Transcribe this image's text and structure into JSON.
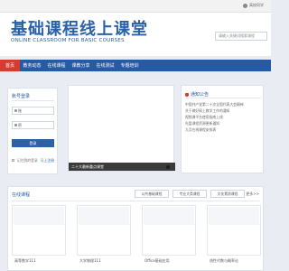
{
  "topbar": {
    "login_label": "高校同学"
  },
  "header": {
    "title": "基础课程线上课堂",
    "subtitle": "ONLINE CLASSROOM FOR BASIC COURSES",
    "search_placeholder": "请输入关键词搜索课程"
  },
  "nav": {
    "items": [
      {
        "label": "首页"
      },
      {
        "label": "教务动态"
      },
      {
        "label": "在线课程"
      },
      {
        "label": "课教分享"
      },
      {
        "label": "在线测试"
      },
      {
        "label": "专题培训"
      }
    ]
  },
  "login": {
    "title": "账号登录",
    "username_placeholder": "账",
    "password_placeholder": "密",
    "button": "登录",
    "remember": "记住我的登录",
    "register": "马上注册"
  },
  "banner": {
    "caption": "二十大最新重点课堂"
  },
  "notice": {
    "title": "通知公告",
    "items": [
      "中国共产党第二十次全国代表大会精神",
      "关于做好网上教学工作的通知",
      "视频课平台使用指南上线",
      "光盘课程资源更新通知",
      "九月在线课程安排表"
    ]
  },
  "courses": {
    "title": "在线课程",
    "filters": [
      "公共基础课程",
      "专业大类课程",
      "文化素质课程"
    ],
    "more": "更多>>",
    "cards": [
      {
        "label": "高等数学111"
      },
      {
        "label": "大学物理111"
      },
      {
        "label": "Office基础应用"
      },
      {
        "label": "线性代数与概率论"
      }
    ]
  }
}
